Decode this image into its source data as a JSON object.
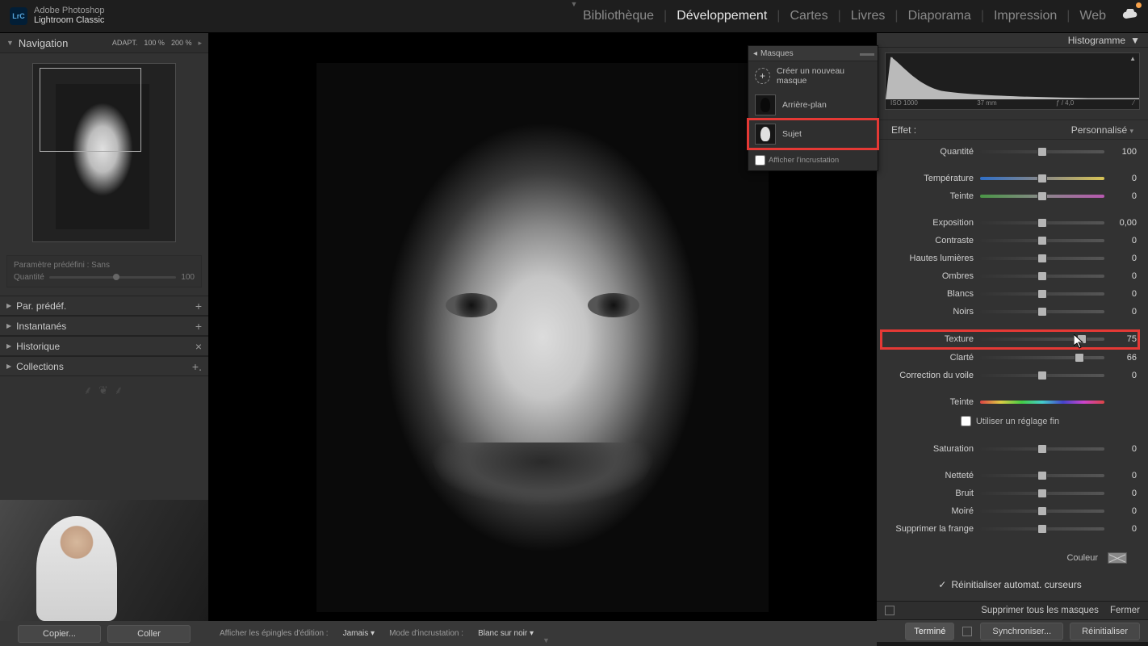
{
  "app": {
    "badge": "LrC",
    "title_line1": "Adobe Photoshop",
    "title_line2": "Lightroom Classic"
  },
  "modules": {
    "items": [
      "Bibliothèque",
      "Développement",
      "Cartes",
      "Livres",
      "Diaporama",
      "Impression",
      "Web"
    ],
    "active": "Développement"
  },
  "left": {
    "nav_title": "Navigation",
    "zoom": {
      "mode": "ADAPT.",
      "levels": [
        "100 %",
        "200 %"
      ]
    },
    "preset": {
      "label": "Paramètre prédéfini :",
      "value": "Sans",
      "qty_label": "Quantité",
      "qty_value": "100"
    },
    "accordions": [
      {
        "label": "Par. prédéf.",
        "action": "+"
      },
      {
        "label": "Instantanés",
        "action": "+"
      },
      {
        "label": "Historique",
        "action": "×"
      },
      {
        "label": "Collections",
        "action": "+."
      }
    ],
    "btn_copy": "Copier...",
    "btn_paste": "Coller"
  },
  "bottom_center": {
    "pins_label": "Afficher les épingles d'édition :",
    "pins_value": "Jamais",
    "overlay_label": "Mode d'incrustation :",
    "overlay_value": "Blanc sur noir"
  },
  "masks": {
    "title": "Masques",
    "new": "Créer un nouveau masque",
    "items": [
      {
        "label": "Arrière-plan"
      },
      {
        "label": "Sujet"
      }
    ],
    "show_overlay": "Afficher l'incrustation"
  },
  "histogram": {
    "title": "Histogramme",
    "iso": "ISO 1000",
    "focal": "37 mm",
    "aperture": "ƒ / 4,0",
    "flash": "⁄"
  },
  "effect": {
    "label": "Effet :",
    "preset": "Personnalisé"
  },
  "sliders": [
    {
      "label": "Quantité",
      "value": "100",
      "pos": 50,
      "group": 0
    },
    {
      "label": "Température",
      "value": "0",
      "pos": 50,
      "track": "temp",
      "group": 1
    },
    {
      "label": "Teinte",
      "value": "0",
      "pos": 50,
      "track": "tint",
      "group": 1
    },
    {
      "label": "Exposition",
      "value": "0,00",
      "pos": 50,
      "group": 2
    },
    {
      "label": "Contraste",
      "value": "0",
      "pos": 50,
      "group": 2
    },
    {
      "label": "Hautes lumières",
      "value": "0",
      "pos": 50,
      "group": 2
    },
    {
      "label": "Ombres",
      "value": "0",
      "pos": 50,
      "group": 2
    },
    {
      "label": "Blancs",
      "value": "0",
      "pos": 50,
      "group": 2
    },
    {
      "label": "Noirs",
      "value": "0",
      "pos": 50,
      "group": 2
    },
    {
      "label": "Texture",
      "value": "75",
      "pos": 82,
      "group": 3,
      "hl": true
    },
    {
      "label": "Clarté",
      "value": "66",
      "pos": 80,
      "group": 3
    },
    {
      "label": "Correction du voile",
      "value": "0",
      "pos": 50,
      "group": 3
    },
    {
      "label": "Teinte",
      "value": "",
      "pos": null,
      "track": "hue",
      "group": 4,
      "noknob": true
    },
    {
      "label": "Saturation",
      "value": "0",
      "pos": 50,
      "group": 5
    },
    {
      "label": "Netteté",
      "value": "0",
      "pos": 50,
      "group": 6
    },
    {
      "label": "Bruit",
      "value": "0",
      "pos": 50,
      "group": 6
    },
    {
      "label": "Moiré",
      "value": "0",
      "pos": 50,
      "group": 6
    },
    {
      "label": "Supprimer la frange",
      "value": "0",
      "pos": 50,
      "group": 6
    }
  ],
  "fine_tune": "Utiliser un réglage fin",
  "color_label": "Couleur",
  "reset_sliders": "Réinitialiser automat. curseurs",
  "footer1": {
    "delete_all": "Supprimer tous les masques",
    "close": "Fermer"
  },
  "footer2": {
    "done": "Terminé",
    "sync": "Synchroniser...",
    "reset": "Réinitialiser"
  }
}
